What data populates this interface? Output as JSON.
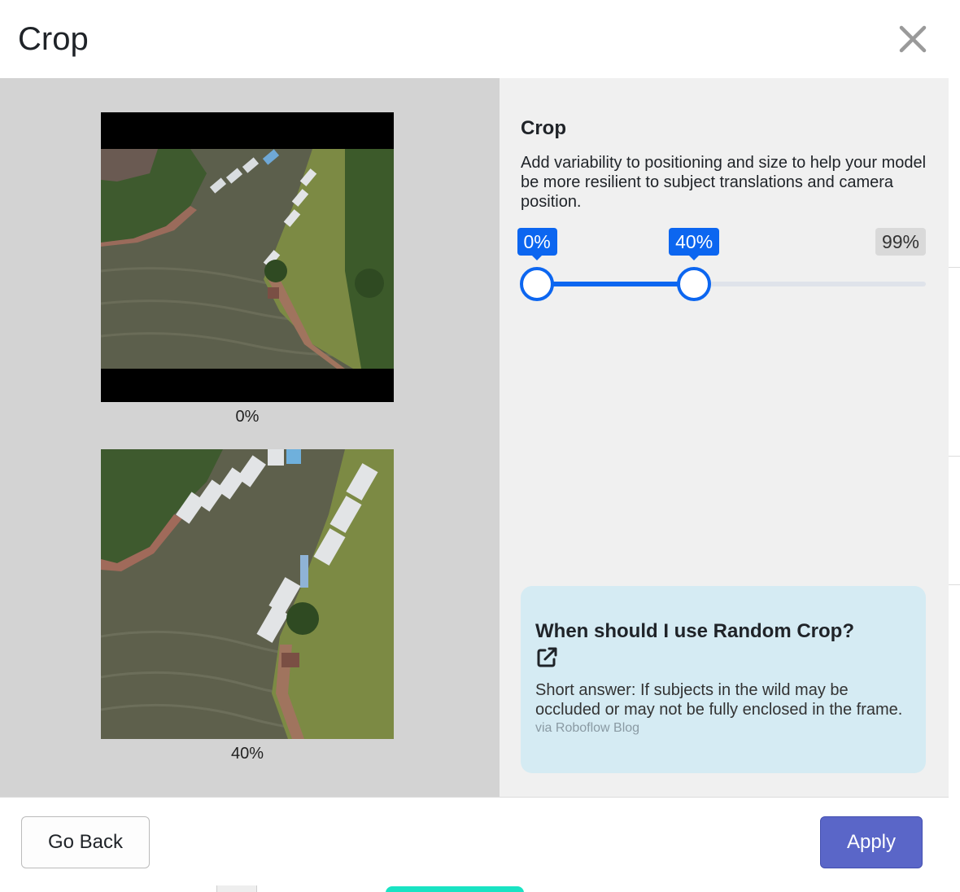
{
  "modal": {
    "title": "Crop",
    "close_icon": "close-icon"
  },
  "previews": [
    {
      "caption": "0%"
    },
    {
      "caption": "40%"
    }
  ],
  "settings": {
    "title": "Crop",
    "description": "Add variability to positioning and size to help your model be more resilient to subject translations and camera position.",
    "slider": {
      "min_label": "0%",
      "value_label": "40%",
      "max_label": "99%",
      "min_value": 0,
      "value": 40,
      "max_value": 99
    }
  },
  "info_card": {
    "question": "When should I use Random Crop?",
    "link_icon": "external-link-icon",
    "answer": "Short answer: If subjects in the wild may be occluded or may not be fully enclosed in the frame.",
    "source": "via Roboflow Blog"
  },
  "footer": {
    "back_label": "Go Back",
    "apply_label": "Apply"
  },
  "colors": {
    "accent": "#0c66f0",
    "apply_button": "#5a66c8",
    "info_card_bg": "#d5ebf3",
    "preview_pane_bg": "#d3d3d3",
    "settings_pane_bg": "#f0f0f0"
  }
}
